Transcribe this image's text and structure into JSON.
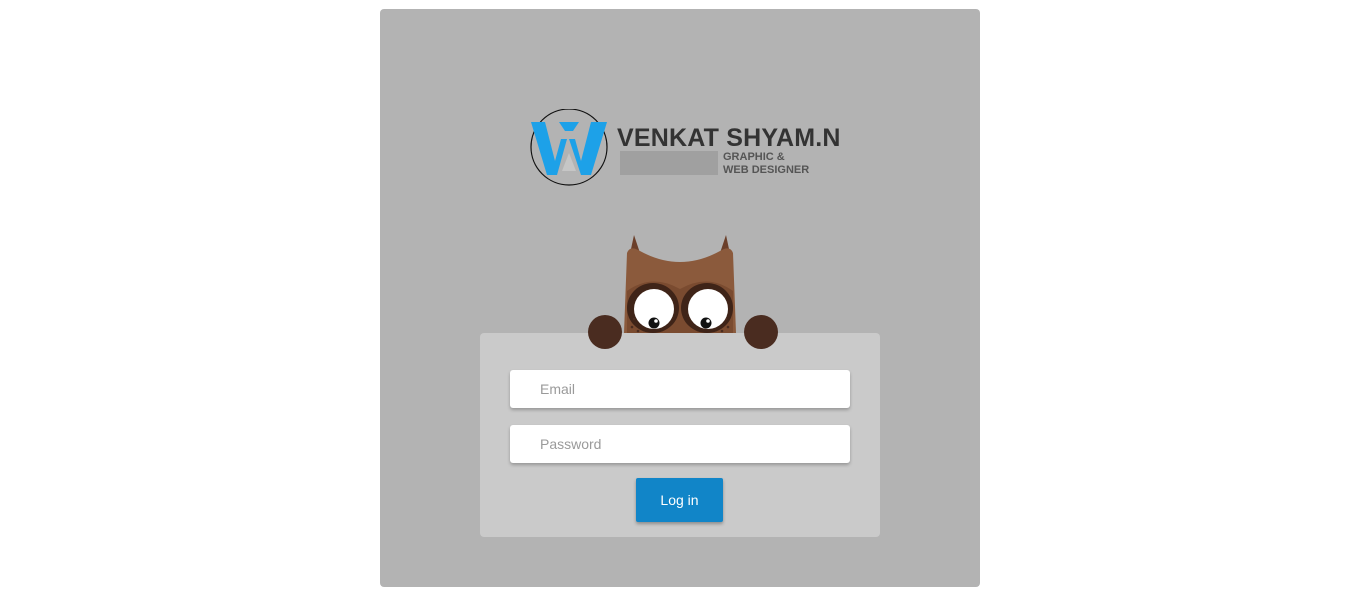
{
  "logo": {
    "name": "VENKAT SHYAM.N",
    "subtitle_line1": "GRAPHIC &",
    "subtitle_line2": "WEB DESIGNER",
    "mark_color": "#1da1e8"
  },
  "form": {
    "email_placeholder": "Email",
    "email_value": "",
    "password_placeholder": "Password",
    "password_value": "",
    "login_label": "Log in"
  },
  "colors": {
    "panel_bg": "#b3b3b3",
    "card_bg": "#cacaca",
    "button_bg": "#1185c8",
    "owl_body": "#8b5a3c",
    "owl_paw": "#4a2c20"
  },
  "icons": {
    "logo": "vs-monogram-logo-icon",
    "mascot": "owl-mascot-icon"
  }
}
